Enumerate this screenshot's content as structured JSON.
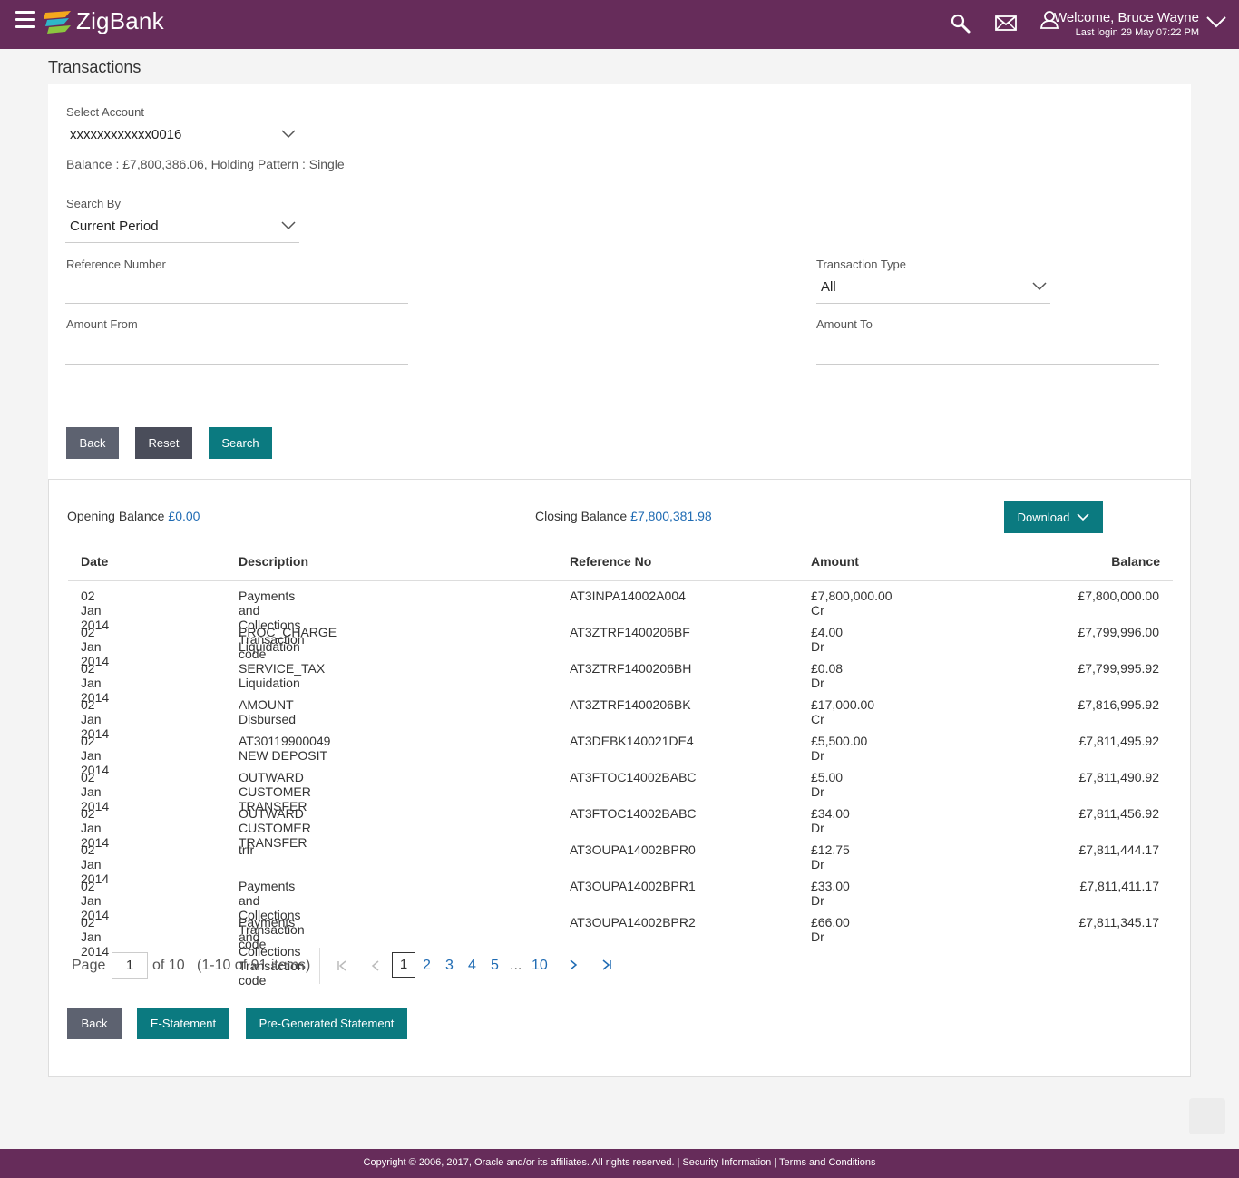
{
  "header": {
    "brand": "ZigBank",
    "welcome": "Welcome, Bruce Wayne",
    "last_login": "Last login 29 May 07:22 PM",
    "color": "#662c5a"
  },
  "page_title": "Transactions",
  "form": {
    "select_account_label": "Select Account",
    "account_value": "xxxxxxxxxxxx0016",
    "balance_info": "Balance : £7,800,386.06, Holding Pattern : Single",
    "search_by_label": "Search By",
    "search_by_value": "Current Period",
    "reference_label": "Reference Number",
    "reference_value": "",
    "transaction_type_label": "Transaction Type",
    "transaction_type_value": "All",
    "amount_from_label": "Amount From",
    "amount_from_value": "",
    "amount_to_label": "Amount To",
    "amount_to_value": "",
    "back": "Back",
    "reset": "Reset",
    "search": "Search"
  },
  "summary": {
    "opening_label": "Opening Balance",
    "opening_value": "£0.00",
    "closing_label": "Closing Balance",
    "closing_value": "£7,800,381.98",
    "download": "Download"
  },
  "table": {
    "columns": [
      "Date",
      "Description",
      "Reference No",
      "Amount",
      "Balance"
    ],
    "rows": [
      [
        "02 Jan 2014",
        "Payments and Collections Transaction code",
        "AT3INPA14002A004",
        "£7,800,000.00 Cr",
        "£7,800,000.00"
      ],
      [
        "02 Jan 2014",
        "PROC_CHARGE Liquidation",
        "AT3ZTRF1400206BF",
        "£4.00 Dr",
        "£7,799,996.00"
      ],
      [
        "02 Jan 2014",
        "SERVICE_TAX Liquidation",
        "AT3ZTRF1400206BH",
        "£0.08 Dr",
        "£7,799,995.92"
      ],
      [
        "02 Jan 2014",
        "AMOUNT Disbursed",
        "AT3ZTRF1400206BK",
        "£17,000.00 Cr",
        "£7,816,995.92"
      ],
      [
        "02 Jan 2014",
        "AT30119900049 NEW DEPOSIT",
        "AT3DEBK140021DE4",
        "£5,500.00 Dr",
        "£7,811,495.92"
      ],
      [
        "02 Jan 2014",
        "OUTWARD CUSTOMER TRANSFER",
        "AT3FTOC14002BABC",
        "£5.00 Dr",
        "£7,811,490.92"
      ],
      [
        "02 Jan 2014",
        "OUTWARD CUSTOMER TRANSFER",
        "AT3FTOC14002BABC",
        "£34.00 Dr",
        "£7,811,456.92"
      ],
      [
        "02 Jan 2014",
        "trfr",
        "AT3OUPA14002BPR0",
        "£12.75 Dr",
        "£7,811,444.17"
      ],
      [
        "02 Jan 2014",
        "Payments and Collections Transaction code",
        "AT3OUPA14002BPR1",
        "£33.00 Dr",
        "£7,811,411.17"
      ],
      [
        "02 Jan 2014",
        "Payments and Collections Transaction code",
        "AT3OUPA14002BPR2",
        "£66.00 Dr",
        "£7,811,345.17"
      ]
    ]
  },
  "pager": {
    "page_label": "Page",
    "page_value": "1",
    "of_text": "of 10",
    "items_text": "(1-10 of 91 items)",
    "current": "1",
    "pages": [
      "2",
      "3",
      "4",
      "5"
    ],
    "ellipsis": "...",
    "last": "10"
  },
  "actions": {
    "back": "Back",
    "estatement": "E-Statement",
    "pregenerated": "Pre-Generated Statement"
  },
  "footer": {
    "text": "Copyright © 2006, 2017, Oracle and/or its affiliates. All rights reserved. | Security Information | Terms and Conditions"
  }
}
